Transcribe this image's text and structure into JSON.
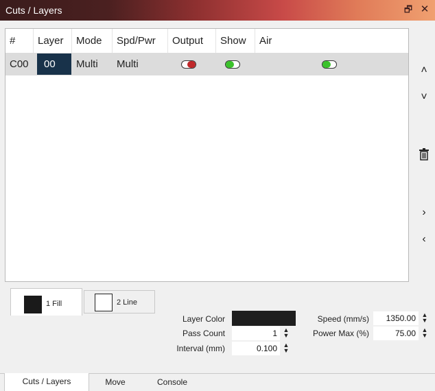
{
  "window": {
    "title": "Cuts / Layers",
    "float_icon": "float-icon",
    "close_icon": "close-icon"
  },
  "grid": {
    "columns": [
      "#",
      "Layer",
      "Mode",
      "Spd/Pwr",
      "Output",
      "Show",
      "Air"
    ],
    "rows": [
      {
        "num": "C00",
        "layer": "00",
        "mode": "Multi",
        "spd_pwr": "Multi",
        "output": "off",
        "show": "on",
        "air": "on"
      }
    ]
  },
  "side_buttons": [
    "move-up-icon",
    "move-down-icon",
    "delete-icon",
    "expand-right-icon",
    "collapse-left-icon"
  ],
  "sub_tabs": [
    {
      "label": "1 Fill",
      "color": "#1a1a1a"
    },
    {
      "label": "2 Line",
      "color": "#ffffff"
    }
  ],
  "settings": {
    "layer_color_label": "Layer Color",
    "layer_color_value": "#1e1e1e",
    "pass_count_label": "Pass Count",
    "pass_count_value": "1",
    "interval_label": "Interval (mm)",
    "interval_value": "0.100",
    "speed_label": "Speed (mm/s)",
    "speed_value": "1350.00",
    "power_max_label": "Power Max (%)",
    "power_max_value": "75.00"
  },
  "bottom_tabs": [
    "Cuts / Layers",
    "Move",
    "Console"
  ],
  "colors": {
    "layer_swatch": "#18324a",
    "toggle_on": "#3bc22b",
    "toggle_off": "#c0282a"
  }
}
